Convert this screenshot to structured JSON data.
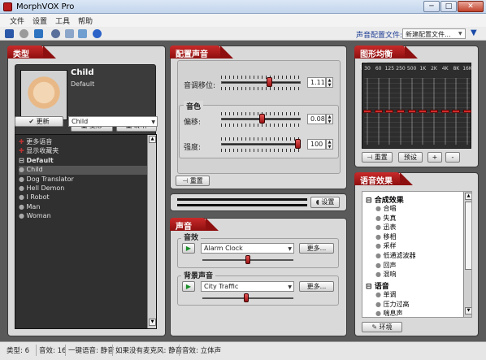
{
  "window": {
    "title": "MorphVOX Pro",
    "min": "─",
    "max": "□",
    "close": "✕"
  },
  "menu": [
    "文件",
    "设置",
    "工具",
    "帮助"
  ],
  "toolbar": {
    "voice_profile_label": "声音配置文件:",
    "voice_profile_value": "新建配置文件..."
  },
  "type_panel": {
    "title": "类型",
    "voice_name": "Child",
    "voice_profile": "Default",
    "morph_button": "变形",
    "listen_button": "聆听",
    "update_button": "更新",
    "voice_select": "Child",
    "more_voices": "更多语音",
    "show_favorites": "显示收藏夹",
    "group": "Default",
    "voices": [
      "Child",
      "Dog Translator",
      "Hell Demon",
      "I Robot",
      "Man",
      "Woman"
    ]
  },
  "config_panel": {
    "title": "配置声音",
    "pitch_label": "音调移位:",
    "pitch_value": "1.11",
    "pitch_level": 0.62,
    "timbre_title": "音色",
    "bias_label": "偏移:",
    "bias_value": "0.08",
    "bias_level": 0.52,
    "strength_label": "强度:",
    "strength_value": "100",
    "strength_level": 1.0,
    "reset_button": "重置"
  },
  "level_bar": {
    "settings_button": "设置"
  },
  "sound_panel": {
    "title": "声音",
    "effects_title": "音效",
    "effect_select": "Alarm Clock",
    "effect_more": "更多...",
    "effect_volume": 0.5,
    "background_title": "背景声音",
    "background_select": "City Traffic",
    "background_more": "更多...",
    "background_volume": 0.49
  },
  "eq_panel": {
    "title": "图形均衡器",
    "bands": [
      "30",
      "60",
      "125",
      "250",
      "500",
      "1K",
      "2K",
      "4K",
      "8K",
      "16K"
    ],
    "levels": [
      0.5,
      0.5,
      0.5,
      0.5,
      0.5,
      0.5,
      0.5,
      0.5,
      0.5,
      0.5
    ],
    "reset_button": "重置",
    "preset_button": "预设",
    "plus_button": "+",
    "minus_button": "-"
  },
  "effects_panel": {
    "title": "语音效果",
    "group1": "合成效果",
    "items1": [
      "合唱",
      "失真",
      "迅表",
      "移相",
      "采样",
      "低通滤波器",
      "回声",
      "混响"
    ],
    "group2": "语音",
    "items2": [
      "单调",
      "压力过高",
      "喘息声"
    ],
    "tweak_button": "环境"
  },
  "status": {
    "voices": "类型: 6",
    "effects": "音效: 16",
    "hotkey": "一键语音: 静音",
    "no_mic": "如果没有麦克风: 静音",
    "audio": "音效: 立体声"
  },
  "colors": {
    "accent": "#b01b1b",
    "panel": "#d9d9d9",
    "chrome": "#5a5a5a"
  }
}
